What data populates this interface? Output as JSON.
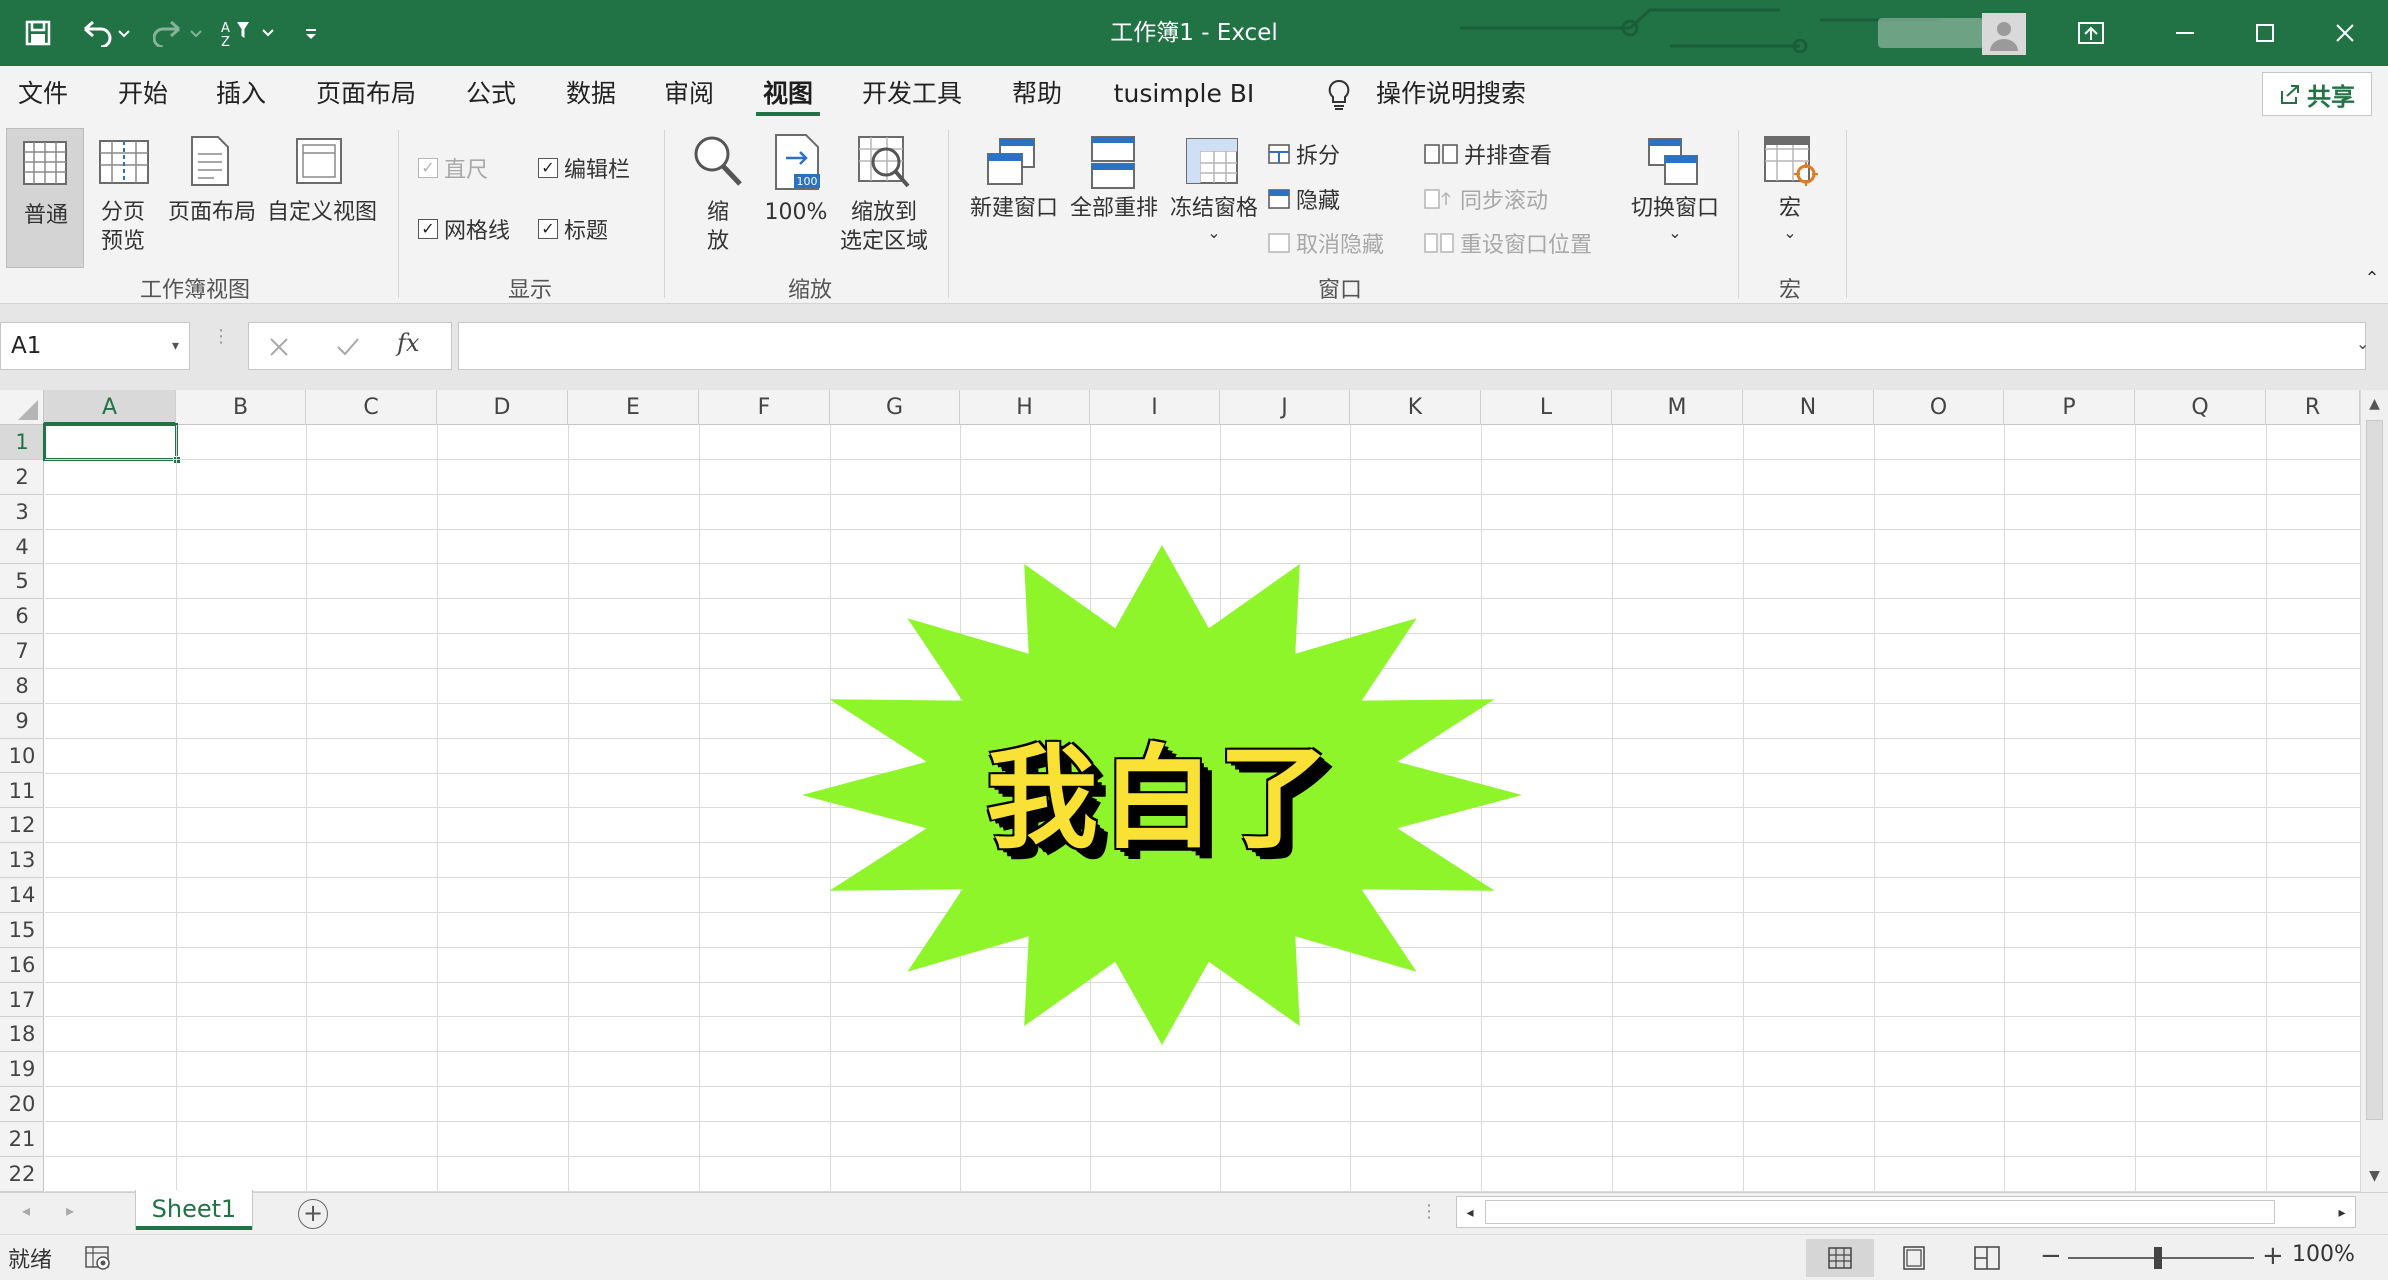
{
  "window": {
    "title": "工作簿1  -  Excel"
  },
  "menu": {
    "tabs": [
      {
        "label": "文件"
      },
      {
        "label": "开始"
      },
      {
        "label": "插入"
      },
      {
        "label": "页面布局"
      },
      {
        "label": "公式"
      },
      {
        "label": "数据"
      },
      {
        "label": "审阅"
      },
      {
        "label": "视图",
        "active": true
      },
      {
        "label": "开发工具"
      },
      {
        "label": "帮助"
      },
      {
        "label": "tusimple BI"
      }
    ],
    "search_label": "操作说明搜索",
    "share_label": "共享"
  },
  "ribbon": {
    "workbook_views": {
      "group_label": "工作簿视图",
      "normal": "普通",
      "page_break_line1": "分页",
      "page_break_line2": "预览",
      "page_layout": "页面布局",
      "custom_views": "自定义视图"
    },
    "show": {
      "group_label": "显示",
      "ruler": {
        "label": "直尺",
        "checked": true,
        "enabled": false
      },
      "formula_bar": {
        "label": "编辑栏",
        "checked": true,
        "enabled": true
      },
      "gridlines": {
        "label": "网格线",
        "checked": true,
        "enabled": true
      },
      "headings": {
        "label": "标题",
        "checked": true,
        "enabled": true
      }
    },
    "zoom": {
      "group_label": "缩放",
      "zoom_line1": "缩",
      "zoom_line2": "放",
      "hundred": "100%",
      "zoom_selection_line1": "缩放到",
      "zoom_selection_line2": "选定区域",
      "badge": "100"
    },
    "window": {
      "group_label": "窗口",
      "new_window": "新建窗口",
      "arrange_all": "全部重排",
      "freeze_panes": "冻结窗格",
      "split": "拆分",
      "hide": "隐藏",
      "unhide": "取消隐藏",
      "side_by_side": "并排查看",
      "sync_scroll": "同步滚动",
      "reset_position": "重设窗口位置",
      "switch_windows": "切换窗口"
    },
    "macros": {
      "group_label": "宏",
      "macros": "宏"
    }
  },
  "formula_bar": {
    "name_box": "A1",
    "fx": "fx",
    "value": ""
  },
  "grid": {
    "columns": [
      "A",
      "B",
      "C",
      "D",
      "E",
      "F",
      "G",
      "H",
      "I",
      "J",
      "K",
      "L",
      "M",
      "N",
      "O",
      "P",
      "Q",
      "R"
    ],
    "rows": [
      "1",
      "2",
      "3",
      "4",
      "5",
      "6",
      "7",
      "8",
      "9",
      "10",
      "11",
      "12",
      "13",
      "14",
      "15",
      "16",
      "17",
      "18",
      "19",
      "20",
      "21",
      "22"
    ],
    "selected_cell": "A1"
  },
  "sticker": {
    "text": "我白了",
    "fill_color": "#8ef52a",
    "text_color": "#f9e235"
  },
  "sheets": [
    {
      "name": "Sheet1",
      "active": true
    }
  ],
  "status": {
    "ready": "就绪",
    "zoom": "100%"
  },
  "colors": {
    "brand": "#217346"
  }
}
